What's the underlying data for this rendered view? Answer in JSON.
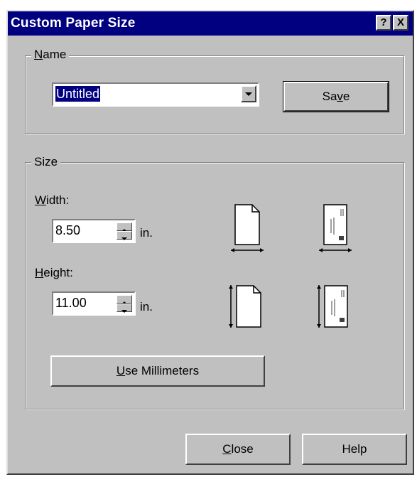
{
  "window": {
    "title": "Custom Paper Size",
    "help_button": "?",
    "close_button": "X"
  },
  "name_group": {
    "legend": "Name",
    "combo_value": "Untitled",
    "save_label": "Save"
  },
  "size_group": {
    "legend": "Size",
    "width_label": "Width:",
    "width_value": "8.50",
    "width_unit": "in.",
    "height_label": "Height:",
    "height_value": "11.00",
    "height_unit": "in.",
    "use_mm_label": "Use Millimeters"
  },
  "buttons": {
    "close_label": "Close",
    "help_label": "Help"
  }
}
